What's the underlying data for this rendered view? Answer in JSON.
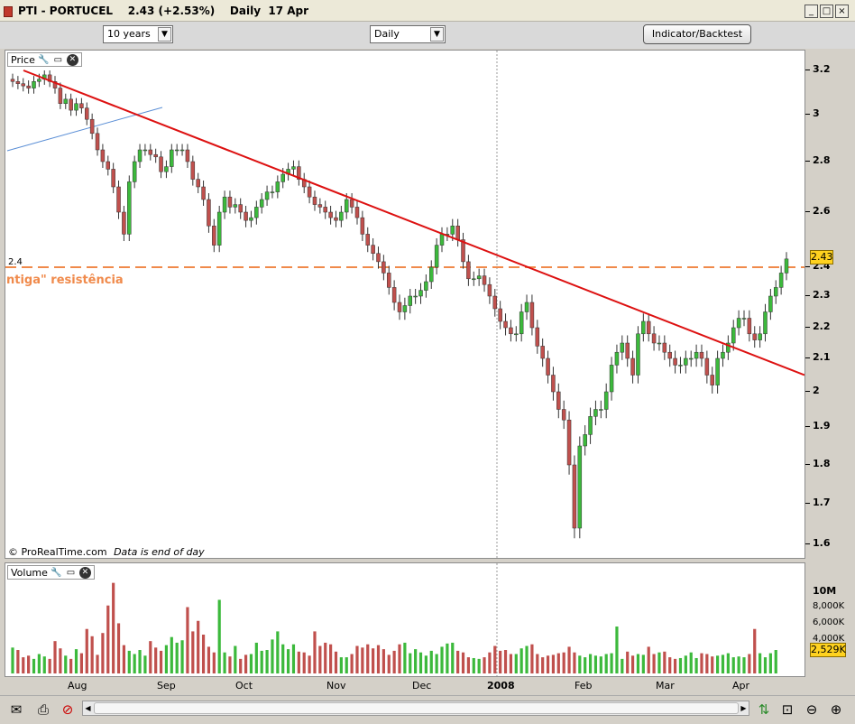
{
  "window": {
    "title": "PTI - PORTUCEL    2.43 (+2.53%)    Daily  17 Apr",
    "minimize": "_",
    "restore": "□",
    "close": "×"
  },
  "toolbar": {
    "period": "10 years",
    "interval": "Daily",
    "indicator_button": "Indicator/Backtest"
  },
  "price_panel": {
    "label": "Price",
    "level_label": "2.4",
    "resistance_text": "ntiga\" resistência",
    "current_price": "2.43",
    "watermark": "© ProRealTime.com",
    "watermark_note": "Data is end of day"
  },
  "volume_panel": {
    "label": "Volume",
    "current_volume": "2,529K"
  },
  "status": {
    "icons": [
      "mail-icon",
      "print-icon",
      "no-icon",
      "chart-icon",
      "zoom-fit-icon",
      "zoom-out-icon",
      "zoom-in-icon"
    ]
  },
  "chart_data": {
    "type": "candlestick",
    "y_ticks": [
      "3.2",
      "3",
      "2.8",
      "2.6",
      "2.4",
      "2.3",
      "2.2",
      "2.1",
      "2",
      "1.9",
      "1.8",
      "1.7",
      "1.6"
    ],
    "x_labels": [
      "Aug",
      "Sep",
      "Oct",
      "Nov",
      "Dec",
      "2008",
      "Feb",
      "Mar",
      "Apr"
    ],
    "volume_ticks": [
      "10M",
      "8,000K",
      "6,000K",
      "4,000K"
    ],
    "resistance_level": 2.4,
    "trendline": {
      "from": {
        "date": "2007-07-20",
        "value": 3.2
      },
      "to": {
        "date": "2008-04-17",
        "value": 2.05
      }
    },
    "colors": {
      "up": "#3cb93c",
      "down": "#c0504d",
      "trend": "#dd1111",
      "resistance": "#f08a4b",
      "blue_line": "#5b8fd6"
    },
    "close_series": [
      3.15,
      3.14,
      3.13,
      3.12,
      3.15,
      3.16,
      3.18,
      3.15,
      3.12,
      3.05,
      3.07,
      3.02,
      3.05,
      3.03,
      2.98,
      2.92,
      2.85,
      2.8,
      2.77,
      2.7,
      2.6,
      2.52,
      2.72,
      2.8,
      2.85,
      2.85,
      2.83,
      2.82,
      2.76,
      2.78,
      2.85,
      2.85,
      2.85,
      2.8,
      2.73,
      2.7,
      2.65,
      2.55,
      2.48,
      2.6,
      2.66,
      2.62,
      2.63,
      2.6,
      2.57,
      2.58,
      2.62,
      2.65,
      2.68,
      2.68,
      2.72,
      2.75,
      2.77,
      2.78,
      2.73,
      2.7,
      2.66,
      2.63,
      2.62,
      2.6,
      2.58,
      2.57,
      2.6,
      2.65,
      2.62,
      2.58,
      2.52,
      2.48,
      2.45,
      2.42,
      2.38,
      2.33,
      2.28,
      2.25,
      2.27,
      2.3,
      2.3,
      2.32,
      2.35,
      2.4,
      2.48,
      2.52,
      2.52,
      2.55,
      2.5,
      2.42,
      2.36,
      2.36,
      2.37,
      2.34,
      2.3,
      2.26,
      2.22,
      2.2,
      2.18,
      2.18,
      2.25,
      2.28,
      2.2,
      2.14,
      2.1,
      2.05,
      2.0,
      1.95,
      1.92,
      1.8,
      1.64,
      1.85,
      1.88,
      1.93,
      1.95,
      1.95,
      2.0,
      2.08,
      2.12,
      2.15,
      2.1,
      2.05,
      2.18,
      2.22,
      2.18,
      2.15,
      2.15,
      2.12,
      2.1,
      2.08,
      2.08,
      2.1,
      2.1,
      2.12,
      2.1,
      2.05,
      2.02,
      2.1,
      2.12,
      2.15,
      2.2,
      2.23,
      2.23,
      2.18,
      2.16,
      2.18,
      2.25,
      2.3,
      2.33,
      2.38,
      2.43
    ],
    "volume_series": [
      3.2,
      2.9,
      2.0,
      2.2,
      1.8,
      2.4,
      2.1,
      1.8,
      4.0,
      3.1,
      2.2,
      1.8,
      3.0,
      2.5,
      5.5,
      4.6,
      2.3,
      5.0,
      8.4,
      11.2,
      6.2,
      3.5,
      2.8,
      2.4,
      2.9,
      2.2,
      4.0,
      3.2,
      2.8,
      3.5,
      4.5,
      3.8,
      4.1,
      8.2,
      5.2,
      6.5,
      4.8,
      3.3,
      2.6,
      9.1,
      2.6,
      2.1,
      3.4,
      1.8,
      2.3,
      2.4,
      3.8,
      2.8,
      2.9,
      4.2,
      5.2,
      3.6,
      3.0,
      3.6,
      2.7,
      2.6,
      2.2,
      5.2,
      3.4,
      3.8,
      3.6,
      2.7,
      2.0,
      2.0,
      2.4,
      3.4,
      3.2,
      3.6,
      3.1,
      3.5,
      3.0,
      2.3,
      2.8,
      3.6,
      3.8,
      2.5,
      3.0,
      2.6,
      2.2,
      2.8,
      2.4,
      3.3,
      3.7,
      3.8,
      2.8,
      2.6,
      2.0,
      1.9,
      1.8,
      2.0,
      2.6,
      3.4,
      2.8,
      2.9,
      2.4,
      2.4,
      3.1,
      3.4,
      3.6,
      2.4,
      2.0,
      2.2,
      2.3,
      2.5,
      2.6,
      3.3,
      2.6,
      2.2,
      2.0,
      2.4,
      2.2,
      2.1,
      2.4,
      2.5,
      5.8,
      1.8,
      2.7,
      2.2,
      2.4,
      2.3,
      3.3,
      2.4,
      2.6,
      2.7,
      2.0,
      1.8,
      1.9,
      2.2,
      2.6,
      1.9,
      2.5,
      2.4,
      2.1,
      2.2,
      2.3,
      2.5,
      2.0,
      2.1,
      2.0,
      2.4,
      5.5,
      2.5,
      2.0,
      2.5,
      2.9
    ]
  }
}
